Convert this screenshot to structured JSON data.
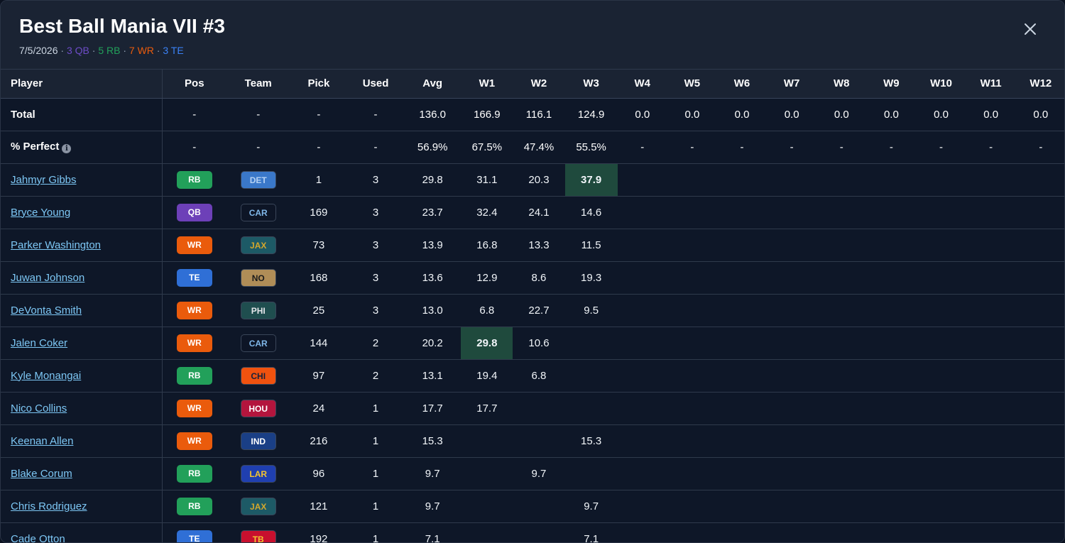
{
  "header": {
    "title": "Best Ball Mania VII #3",
    "date": "7/5/2026",
    "sep": "·",
    "qb_count": "3 QB",
    "rb_count": "5 RB",
    "wr_count": "7 WR",
    "te_count": "3 TE"
  },
  "columns": [
    "Player",
    "Pos",
    "Team",
    "Pick",
    "Used",
    "Avg",
    "W1",
    "W2",
    "W3",
    "W4",
    "W5",
    "W6",
    "W7",
    "W8",
    "W9",
    "W10",
    "W11",
    "W12"
  ],
  "total_row": {
    "label": "Total",
    "pos": "-",
    "team": "-",
    "pick": "-",
    "used": "-",
    "avg": "136.0",
    "weeks": [
      "166.9",
      "116.1",
      "124.9",
      "0.0",
      "0.0",
      "0.0",
      "0.0",
      "0.0",
      "0.0",
      "0.0",
      "0.0",
      "0.0"
    ]
  },
  "perfect_row": {
    "label": "% Perfect",
    "info_icon": "i",
    "pos": "-",
    "team": "-",
    "pick": "-",
    "used": "-",
    "avg": "56.9%",
    "weeks": [
      "67.5%",
      "47.4%",
      "55.5%",
      "-",
      "-",
      "-",
      "-",
      "-",
      "-",
      "-",
      "-",
      "-"
    ]
  },
  "colors": {
    "pos": {
      "RB": "#22a05a",
      "QB": "#6d40b8",
      "WR": "#ea5b0c",
      "TE": "#2f6fd6"
    },
    "teams": {
      "DET": {
        "bg": "#3a78c9",
        "fg": "#b6d2f3"
      },
      "CAR": {
        "bg": "#0d1526",
        "fg": "#7fb6e8"
      },
      "JAX": {
        "bg": "#1d5a66",
        "fg": "#d3a72c"
      },
      "NO": {
        "bg": "#b08d57",
        "fg": "#1b1b1b"
      },
      "PHI": {
        "bg": "#1f4e4f",
        "fg": "#e5e7eb"
      },
      "CHI": {
        "bg": "#f0520f",
        "fg": "#16213a"
      },
      "HOU": {
        "bg": "#b3153d",
        "fg": "#ffffff"
      },
      "IND": {
        "bg": "#1a3f86",
        "fg": "#ffffff"
      },
      "LAR": {
        "bg": "#1f3fb0",
        "fg": "#f4c430"
      },
      "TB": {
        "bg": "#c8102e",
        "fg": "#f4c430"
      }
    }
  },
  "players": [
    {
      "name": "Jahmyr Gibbs",
      "pos": "RB",
      "team": "DET",
      "pick": "1",
      "used": "3",
      "avg": "29.8",
      "weeks": [
        "31.1",
        "20.3",
        "37.9",
        "",
        "",
        "",
        "",
        "",
        "",
        "",
        "",
        ""
      ],
      "best_week": 2
    },
    {
      "name": "Bryce Young",
      "pos": "QB",
      "team": "CAR",
      "pick": "169",
      "used": "3",
      "avg": "23.7",
      "weeks": [
        "32.4",
        "24.1",
        "14.6",
        "",
        "",
        "",
        "",
        "",
        "",
        "",
        "",
        ""
      ],
      "best_week": -1
    },
    {
      "name": "Parker Washington",
      "pos": "WR",
      "team": "JAX",
      "pick": "73",
      "used": "3",
      "avg": "13.9",
      "weeks": [
        "16.8",
        "13.3",
        "11.5",
        "",
        "",
        "",
        "",
        "",
        "",
        "",
        "",
        ""
      ],
      "best_week": -1
    },
    {
      "name": "Juwan Johnson",
      "pos": "TE",
      "team": "NO",
      "pick": "168",
      "used": "3",
      "avg": "13.6",
      "weeks": [
        "12.9",
        "8.6",
        "19.3",
        "",
        "",
        "",
        "",
        "",
        "",
        "",
        "",
        ""
      ],
      "best_week": -1
    },
    {
      "name": "DeVonta Smith",
      "pos": "WR",
      "team": "PHI",
      "pick": "25",
      "used": "3",
      "avg": "13.0",
      "weeks": [
        "6.8",
        "22.7",
        "9.5",
        "",
        "",
        "",
        "",
        "",
        "",
        "",
        "",
        ""
      ],
      "best_week": -1
    },
    {
      "name": "Jalen Coker",
      "pos": "WR",
      "team": "CAR",
      "pick": "144",
      "used": "2",
      "avg": "20.2",
      "weeks": [
        "29.8",
        "10.6",
        "",
        "",
        "",
        "",
        "",
        "",
        "",
        "",
        "",
        ""
      ],
      "best_week": 0
    },
    {
      "name": "Kyle Monangai",
      "pos": "RB",
      "team": "CHI",
      "pick": "97",
      "used": "2",
      "avg": "13.1",
      "weeks": [
        "19.4",
        "6.8",
        "",
        "",
        "",
        "",
        "",
        "",
        "",
        "",
        "",
        ""
      ],
      "best_week": -1
    },
    {
      "name": "Nico Collins",
      "pos": "WR",
      "team": "HOU",
      "pick": "24",
      "used": "1",
      "avg": "17.7",
      "weeks": [
        "17.7",
        "",
        "",
        "",
        "",
        "",
        "",
        "",
        "",
        "",
        "",
        ""
      ],
      "best_week": -1
    },
    {
      "name": "Keenan Allen",
      "pos": "WR",
      "team": "IND",
      "pick": "216",
      "used": "1",
      "avg": "15.3",
      "weeks": [
        "",
        "",
        "15.3",
        "",
        "",
        "",
        "",
        "",
        "",
        "",
        "",
        ""
      ],
      "best_week": -1
    },
    {
      "name": "Blake Corum",
      "pos": "RB",
      "team": "LAR",
      "pick": "96",
      "used": "1",
      "avg": "9.7",
      "weeks": [
        "",
        "9.7",
        "",
        "",
        "",
        "",
        "",
        "",
        "",
        "",
        "",
        ""
      ],
      "best_week": -1
    },
    {
      "name": "Chris Rodriguez",
      "pos": "RB",
      "team": "JAX",
      "pick": "121",
      "used": "1",
      "avg": "9.7",
      "weeks": [
        "",
        "",
        "9.7",
        "",
        "",
        "",
        "",
        "",
        "",
        "",
        "",
        ""
      ],
      "best_week": -1
    },
    {
      "name": "Cade Otton",
      "pos": "TE",
      "team": "TB",
      "pick": "192",
      "used": "1",
      "avg": "7.1",
      "weeks": [
        "",
        "",
        "7.1",
        "",
        "",
        "",
        "",
        "",
        "",
        "",
        "",
        ""
      ],
      "best_week": -1
    }
  ]
}
